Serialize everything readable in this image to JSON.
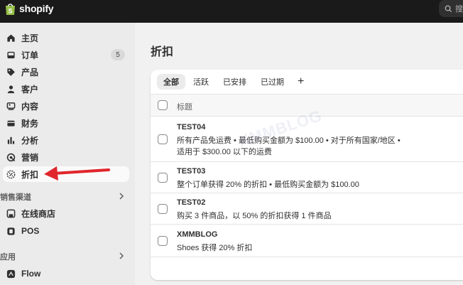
{
  "topbar": {
    "brand": "shopify",
    "search_text": "搜"
  },
  "sidebar": {
    "items": [
      {
        "label": "主页"
      },
      {
        "label": "订单",
        "badge": "5"
      },
      {
        "label": "产品"
      },
      {
        "label": "客户"
      },
      {
        "label": "内容"
      },
      {
        "label": "财务"
      },
      {
        "label": "分析"
      },
      {
        "label": "营销"
      },
      {
        "label": "折扣"
      }
    ],
    "sales_channels": {
      "label": "销售渠道",
      "items": [
        {
          "label": "在线商店"
        },
        {
          "label": "POS"
        }
      ]
    },
    "apps": {
      "label": "应用",
      "items": [
        {
          "label": "Flow"
        }
      ]
    }
  },
  "main": {
    "title": "折扣",
    "tabs": [
      {
        "label": "全部"
      },
      {
        "label": "活跃"
      },
      {
        "label": "已安排"
      },
      {
        "label": "已过期"
      }
    ],
    "add_tab": "+",
    "table_header": "标题",
    "rows": [
      {
        "title": "TEST04",
        "lines": [
          "所有产品免运费 • 最低购买金额为 $100.00 • 对于所有国家/地区 •",
          "适用于 $300.00 以下的运费"
        ]
      },
      {
        "title": "TEST03",
        "lines": [
          "整个订单获得 20% 的折扣 • 最低购买金额为 $100.00"
        ]
      },
      {
        "title": "TEST02",
        "lines": [
          "购买 3 件商品，以 50% 的折扣获得 1 件商品"
        ]
      },
      {
        "title": "XMMBLOG",
        "lines": [
          "Shoes 获得 20% 折扣"
        ]
      }
    ],
    "watermark": "XMMBLOG"
  },
  "colors": {
    "topbar": "#1a1a1a",
    "sidebar": "#ebebeb",
    "background": "#f1f1f1",
    "annotation_arrow": "#e0262c"
  }
}
